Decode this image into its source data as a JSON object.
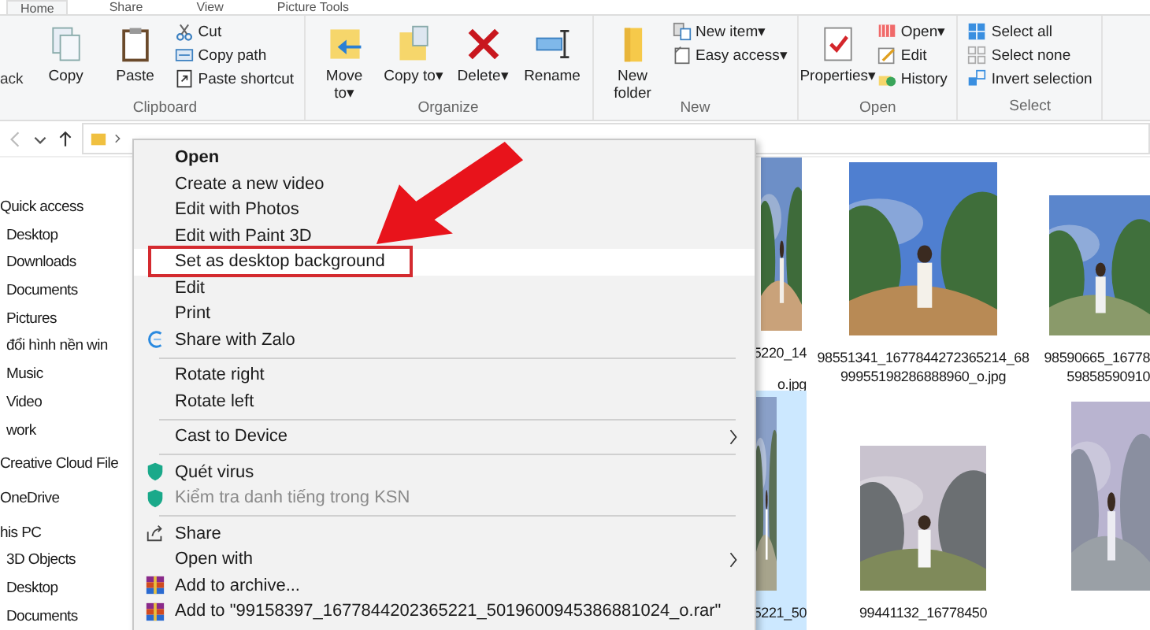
{
  "ribbon": {
    "tabs": [
      {
        "label": "Home",
        "selected": true
      },
      {
        "label": "Share",
        "selected": false
      },
      {
        "label": "View",
        "selected": false
      },
      {
        "label": "Picture Tools",
        "selected": false
      }
    ],
    "cut_label": "ack",
    "groups": [
      {
        "label": "Clipboard",
        "large": [
          {
            "label": "Copy"
          },
          {
            "label": "Paste"
          }
        ],
        "small": [
          {
            "label": "Cut"
          },
          {
            "label": "Copy path"
          },
          {
            "label": "Paste shortcut"
          }
        ]
      },
      {
        "label": "Organize",
        "large": [
          {
            "label": "Move to",
            "caret": "▾"
          },
          {
            "label": "Copy to",
            "caret": "▾"
          },
          {
            "label": "Delete",
            "caret": "▾"
          },
          {
            "label": "Rename"
          }
        ]
      },
      {
        "label": "New",
        "large": [
          {
            "label": "New folder"
          }
        ],
        "small": [
          {
            "label": "New item",
            "caret": "▾"
          },
          {
            "label": "Easy access",
            "caret": "▾"
          }
        ]
      },
      {
        "label": "Open",
        "large": [
          {
            "label": "Properties",
            "caret": "▾"
          }
        ],
        "small": [
          {
            "label": "Open",
            "caret": "▾"
          },
          {
            "label": "Edit"
          },
          {
            "label": "History"
          }
        ]
      },
      {
        "label": "Select",
        "small": [
          {
            "label": "Select all"
          },
          {
            "label": "Select none"
          },
          {
            "label": "Invert selection"
          }
        ]
      }
    ]
  },
  "sidebar": {
    "items": [
      {
        "label": "Quick access",
        "children": [
          {
            "label": "Desktop"
          },
          {
            "label": "Downloads"
          },
          {
            "label": "Documents"
          },
          {
            "label": "Pictures"
          },
          {
            "label": "đổi hình nền win"
          },
          {
            "label": "Music"
          },
          {
            "label": "Video"
          },
          {
            "label": "work"
          }
        ]
      },
      {
        "label": "Creative Cloud File"
      },
      {
        "label": "OneDrive"
      },
      {
        "label": "his PC",
        "children": [
          {
            "label": "3D Objects"
          },
          {
            "label": "Desktop"
          },
          {
            "label": "Documents"
          }
        ]
      }
    ]
  },
  "context_menu": {
    "items": [
      {
        "kind": "item",
        "label": "Open",
        "bold": true,
        "highlighted": false
      },
      {
        "kind": "item",
        "label": "Create a new video",
        "highlighted": false
      },
      {
        "kind": "item",
        "label": "Edit with Photos",
        "highlighted": false
      },
      {
        "kind": "item",
        "label": "Edit with Paint 3D",
        "highlighted": false
      },
      {
        "kind": "item",
        "label": "Set as desktop background",
        "highlighted": true,
        "outlined": true
      },
      {
        "kind": "item",
        "label": "Edit",
        "highlighted": false
      },
      {
        "kind": "item",
        "label": "Print",
        "highlighted": false
      },
      {
        "kind": "item",
        "label": "Share with Zalo",
        "highlighted": false
      },
      {
        "kind": "separator"
      },
      {
        "kind": "item",
        "label": "Rotate right",
        "highlighted": false
      },
      {
        "kind": "item",
        "label": "Rotate left",
        "highlighted": false
      },
      {
        "kind": "separator"
      },
      {
        "kind": "item",
        "label": "Cast to Device",
        "highlighted": false,
        "submenu": true
      },
      {
        "kind": "separator"
      },
      {
        "kind": "item",
        "label": "Quét virus",
        "highlighted": false
      },
      {
        "kind": "item",
        "label": "Kiểm tra danh tiếng trong KSN",
        "highlighted": false,
        "disabled": true
      },
      {
        "kind": "separator"
      },
      {
        "kind": "item",
        "label": "Share",
        "highlighted": false
      },
      {
        "kind": "item",
        "label": "Open with",
        "highlighted": false,
        "submenu": true
      },
      {
        "kind": "item",
        "label": "Add to archive...",
        "highlighted": false
      },
      {
        "kind": "item",
        "label": "Add to \"99158397_1677844202365221_5019600945386881024_o.rar\"",
        "highlighted": false
      }
    ]
  },
  "files": [
    {
      "lines": [
        "5220_14",
        "o.jpg"
      ],
      "selected": false
    },
    {
      "lines": [
        "98551341_1677844272365214_68",
        "99955198286888960_o.jpg"
      ],
      "selected": false
    },
    {
      "lines": [
        "98590665_16778",
        "59858590910"
      ],
      "selected": false
    },
    {
      "lines": [
        "5221_50"
      ],
      "selected": true
    },
    {
      "lines": [
        "99441132_16778450"
      ],
      "selected": false
    },
    {
      "selected": false
    }
  ]
}
